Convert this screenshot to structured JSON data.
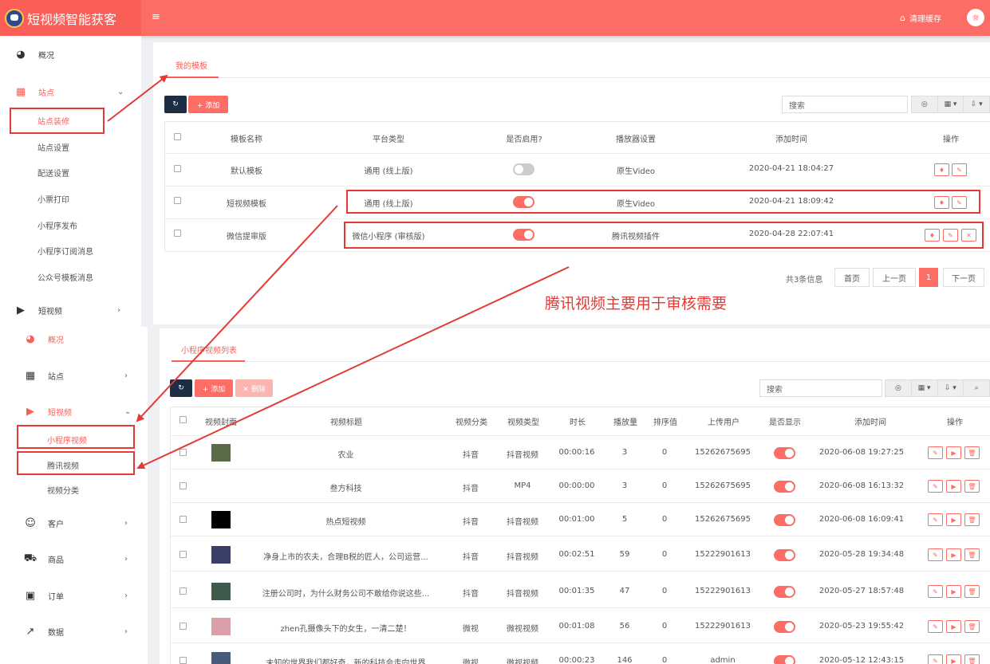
{
  "app": {
    "title": "短视频智能获客",
    "menu_glyph": "≡",
    "clear_cache": "清理缓存",
    "avatar_text": "㊖"
  },
  "sidebar_top": {
    "overview": "概况",
    "site": "站点",
    "site_subs": [
      "站点装修",
      "站点设置",
      "配送设置",
      "小票打印",
      "小程序发布",
      "小程序订阅消息",
      "公众号模板消息"
    ],
    "short_video": "短视频"
  },
  "sidebar_bottom": {
    "overview": "概况",
    "site": "站点",
    "short_video": "短视频",
    "video_subs": [
      "小程序视频",
      "腾讯视频",
      "视频分类"
    ],
    "customer": "客户",
    "goods": "商品",
    "order": "订单",
    "data": "数据"
  },
  "panel1": {
    "tab": "我的模板",
    "refresh_glyph": "↻",
    "add_label": "+ 添加",
    "search_placeholder": "搜索",
    "tools": [
      "◎",
      "▦ ▾",
      "⇩ ▾"
    ],
    "columns": [
      "模板名称",
      "平台类型",
      "是否启用?",
      "播放器设置",
      "添加时间",
      "操作"
    ],
    "rows": [
      {
        "name": "默认模板",
        "platform": "通用 (线上版)",
        "enabled": false,
        "player": "原生Video",
        "time": "2020-04-21 18:04:27",
        "actions": [
          "♦",
          "✎"
        ]
      },
      {
        "name": "短视频模板",
        "platform": "通用 (线上版)",
        "enabled": true,
        "player": "原生Video",
        "time": "2020-04-21 18:09:42",
        "actions": [
          "♦",
          "✎"
        ]
      },
      {
        "name": "微信提审版",
        "platform": "微信小程序 (审核版)",
        "enabled": true,
        "player": "腾讯视频插件",
        "time": "2020-04-28 22:07:41",
        "actions": [
          "♦",
          "✎",
          "✕"
        ]
      }
    ],
    "pager": {
      "info": "共3条信息",
      "first": "首页",
      "prev": "上一页",
      "current": "1",
      "next": "下一页"
    }
  },
  "annotation": "腾讯视频主要用于审核需要",
  "panel2": {
    "tab": "小程序视频列表",
    "refresh_glyph": "↻",
    "add_label": "+ 添加",
    "delete_label": "✕ 删除",
    "search_placeholder": "搜索",
    "tools": [
      "◎",
      "▦ ▾",
      "⇩ ▾",
      "⌕"
    ],
    "columns": [
      "视频封面",
      "视频标题",
      "视频分类",
      "视频类型",
      "时长",
      "播放量",
      "排序值",
      "上传用户",
      "是否显示",
      "添加时间",
      "操作"
    ],
    "row_actions": [
      "✎",
      "▶",
      "🗑"
    ],
    "rows": [
      {
        "title": "农业",
        "category": "抖音",
        "type": "抖音视频",
        "duration": "00:00:16",
        "plays": "3",
        "sort": "0",
        "user": "15262675695",
        "time": "2020-06-08 19:27:25",
        "thumb": "#5a6b4a"
      },
      {
        "title": "叁方科技",
        "category": "抖音",
        "type": "MP4",
        "duration": "00:00:00",
        "plays": "3",
        "sort": "0",
        "user": "15262675695",
        "time": "2020-06-08 16:13:32",
        "thumb": ""
      },
      {
        "title": "热点短视频",
        "category": "抖音",
        "type": "抖音视频",
        "duration": "00:01:00",
        "plays": "5",
        "sort": "0",
        "user": "15262675695",
        "time": "2020-06-08 16:09:41",
        "thumb": "#000000"
      },
      {
        "title": "净身上市的农夫，合理B税的匠人，公司运营...",
        "category": "抖音",
        "type": "抖音视频",
        "duration": "00:02:51",
        "plays": "59",
        "sort": "0",
        "user": "15222901613",
        "time": "2020-05-28 19:34:48",
        "thumb": "#3a3f6a"
      },
      {
        "title": "注册公司时，为什么财务公司不敢给你说这些...",
        "category": "抖音",
        "type": "抖音视频",
        "duration": "00:01:35",
        "plays": "47",
        "sort": "0",
        "user": "15222901613",
        "time": "2020-05-27 18:57:48",
        "thumb": "#3d5a4a"
      },
      {
        "title": "zhen孔摄像头下的女生，一清二楚！",
        "category": "微视",
        "type": "微视视频",
        "duration": "00:01:08",
        "plays": "56",
        "sort": "0",
        "user": "15222901613",
        "time": "2020-05-23 19:55:42",
        "thumb": "#d9a0a8"
      },
      {
        "title": "未知的世界我们都好奇，新的科技会走向世界",
        "category": "微视",
        "type": "微视视频",
        "duration": "00:00:23",
        "plays": "146",
        "sort": "0",
        "user": "admin",
        "time": "2020-05-12 12:43:15",
        "thumb": "#4a5a7a"
      }
    ]
  },
  "colors": {
    "brand": "#fb6d65",
    "annotation": "#e53935",
    "dark_button": "#1d2d44"
  }
}
